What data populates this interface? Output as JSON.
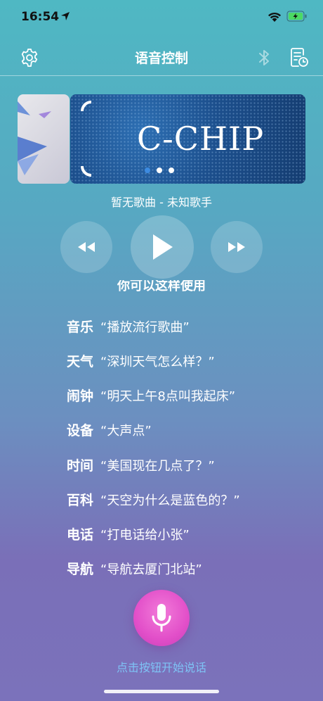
{
  "status_bar": {
    "time": "16:54"
  },
  "navbar": {
    "title": "语音控制"
  },
  "banner": {
    "text": "C-CHIP",
    "page_count": 3,
    "active_page": 0
  },
  "now_playing": {
    "text": "暂无歌曲 - 未知歌手"
  },
  "usage": {
    "title": "你可以这样使用",
    "examples": [
      {
        "category": "音乐",
        "phrase": "“播放流行歌曲”"
      },
      {
        "category": "天气",
        "phrase": "“深圳天气怎么样？”"
      },
      {
        "category": "闹钟",
        "phrase": "“明天上午8点叫我起床”"
      },
      {
        "category": "设备",
        "phrase": "“大声点”"
      },
      {
        "category": "时间",
        "phrase": "“美国现在几点了？”"
      },
      {
        "category": "百科",
        "phrase": "“天空为什么是蓝色的？”"
      },
      {
        "category": "电话",
        "phrase": "“打电话给小张”"
      },
      {
        "category": "导航",
        "phrase": "“导航去厦门北站”"
      }
    ]
  },
  "mic": {
    "hint": "点击按钮开始说话"
  },
  "colors": {
    "accent_blue": "#3d8be0",
    "mic_pink": "#e24fc9",
    "hint_blue": "#7ec3f5",
    "battery_green": "#4cd964"
  }
}
